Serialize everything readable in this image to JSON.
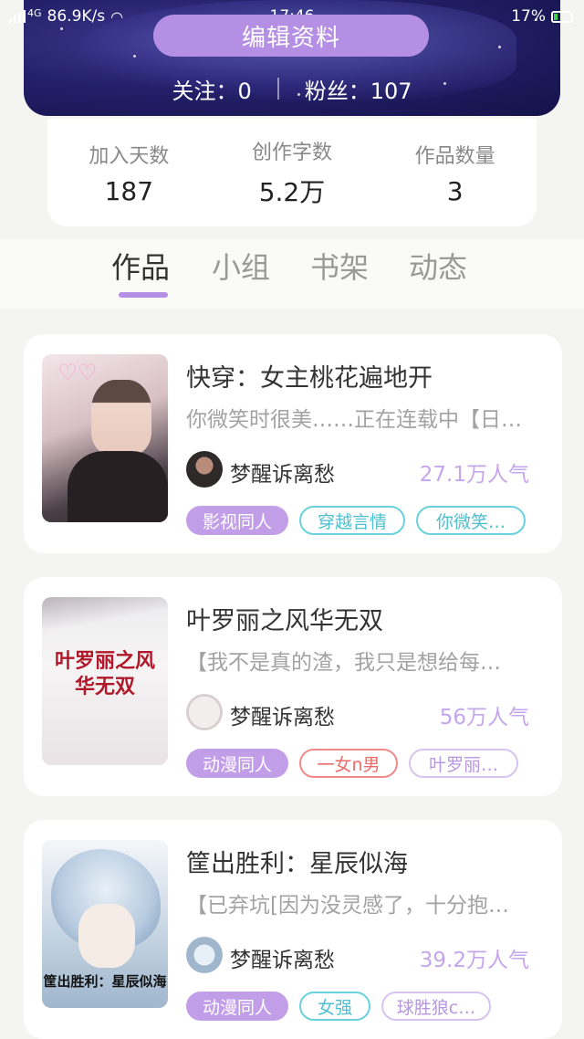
{
  "status_bar": {
    "network": "4G",
    "speed": "86.9K/s",
    "time": "17:46",
    "battery": "17%"
  },
  "header": {
    "edit_button": "编辑资料",
    "follow_label": "关注：0",
    "fans_label": "粉丝：107"
  },
  "stats": [
    {
      "label": "加入天数",
      "value": "187"
    },
    {
      "label": "创作字数",
      "value": "5.2万"
    },
    {
      "label": "作品数量",
      "value": "3"
    }
  ],
  "tabs": [
    "作品",
    "小组",
    "书架",
    "动态"
  ],
  "active_tab": "作品",
  "works": [
    {
      "title": "快穿：女主桃花遍地开",
      "desc": "你微笑时很美……正在连载中【日…",
      "author": "梦醒诉离愁",
      "popularity": "27.1万人气",
      "tags": [
        {
          "text": "影视同人",
          "style": "purple"
        },
        {
          "text": "穿越言情",
          "style": "cyan"
        },
        {
          "text": "你微笑…",
          "style": "cyan"
        }
      ]
    },
    {
      "title": "叶罗丽之风华无双",
      "desc": "【我不是真的渣，我只是想给每…",
      "author": "梦醒诉离愁",
      "popularity": "56万人气",
      "cover_text": "叶罗丽之风华无双",
      "tags": [
        {
          "text": "动漫同人",
          "style": "purple"
        },
        {
          "text": "一女n男",
          "style": "red"
        },
        {
          "text": "叶罗丽…",
          "style": "lilac"
        }
      ]
    },
    {
      "title": "筐出胜利：星辰似海",
      "desc": "【已弃坑[因为没灵感了，十分抱…",
      "author": "梦醒诉离愁",
      "popularity": "39.2万人气",
      "cover_text": "筐出胜利：星辰似海",
      "tags": [
        {
          "text": "动漫同人",
          "style": "purple"
        },
        {
          "text": "女强",
          "style": "cyan"
        },
        {
          "text": "球胜狼c…",
          "style": "lilac"
        }
      ]
    }
  ],
  "colors": {
    "accent": "#b48fe3",
    "popularity": "#c5a6ec",
    "tag_cyan": "#69d2de",
    "tag_red": "#f08a88"
  }
}
